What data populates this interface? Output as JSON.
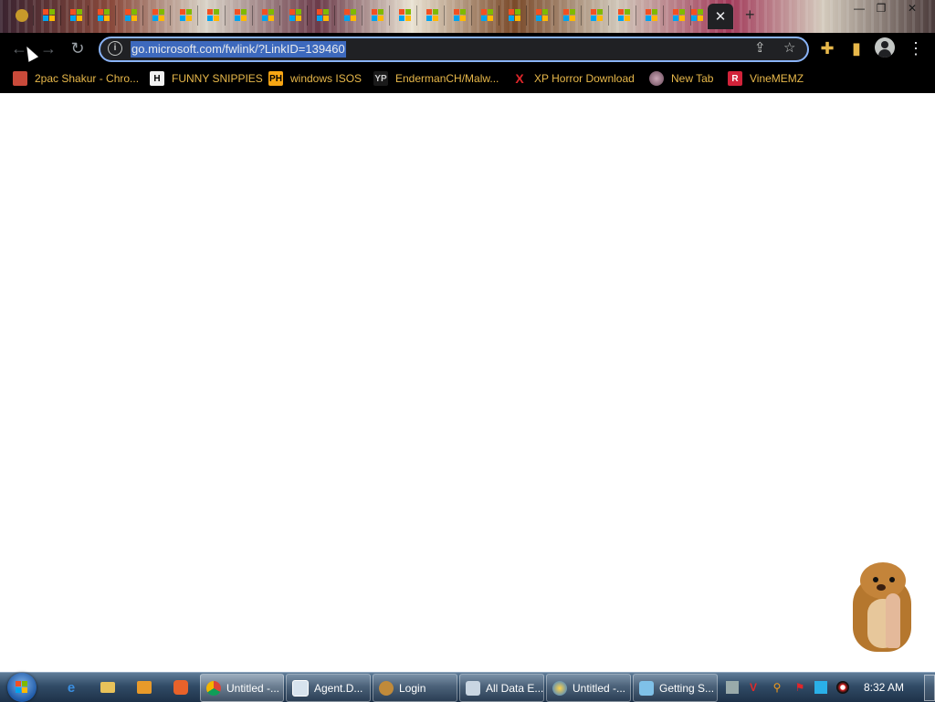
{
  "browser": {
    "url": "go.microsoft.com/fwlink/?LinkID=139460",
    "close_tab_glyph": "✕",
    "new_tab_glyph": "+"
  },
  "window_controls": {
    "minimize": "—",
    "maximize": "❐",
    "close": "✕"
  },
  "toolbar": {
    "back": "←",
    "forward": "→",
    "reload": "↻",
    "share": "⇪",
    "bookmark": "☆",
    "extensions": "✚",
    "sidepanel": "▮",
    "menu": "⋮"
  },
  "bookmarks": [
    {
      "label": "2pac Shakur - Chro...",
      "icon": "app-icon",
      "badge": ""
    },
    {
      "label": "FUNNY SNIPPIES",
      "icon": "h-icon",
      "badge": "H"
    },
    {
      "label": "windows ISOS",
      "icon": "ph-icon",
      "badge": "PH"
    },
    {
      "label": "EndermanCH/Malw...",
      "icon": "yp-icon",
      "badge": "YP"
    },
    {
      "label": "XP Horror Download",
      "icon": "x-icon",
      "badge": "X"
    },
    {
      "label": "New Tab",
      "icon": "globe-icon",
      "badge": ""
    },
    {
      "label": "VineMEMZ",
      "icon": "r-icon",
      "badge": "R"
    }
  ],
  "taskbar": {
    "tasks": [
      {
        "label": "Untitled -...",
        "icon": "chrome-icon"
      },
      {
        "label": "Agent.D...",
        "icon": "window-icon"
      },
      {
        "label": "Login",
        "icon": "user-icon"
      },
      {
        "label": "All Data E...",
        "icon": "folder-icon"
      },
      {
        "label": "Untitled -...",
        "icon": "paint-icon"
      },
      {
        "label": "Getting S...",
        "icon": "doc-icon"
      }
    ],
    "clock": "8:32 AM"
  },
  "colors": {
    "accent": "#8ab4f8",
    "selection": "#3d69bd",
    "bookmark_text": "#e8b84a"
  }
}
